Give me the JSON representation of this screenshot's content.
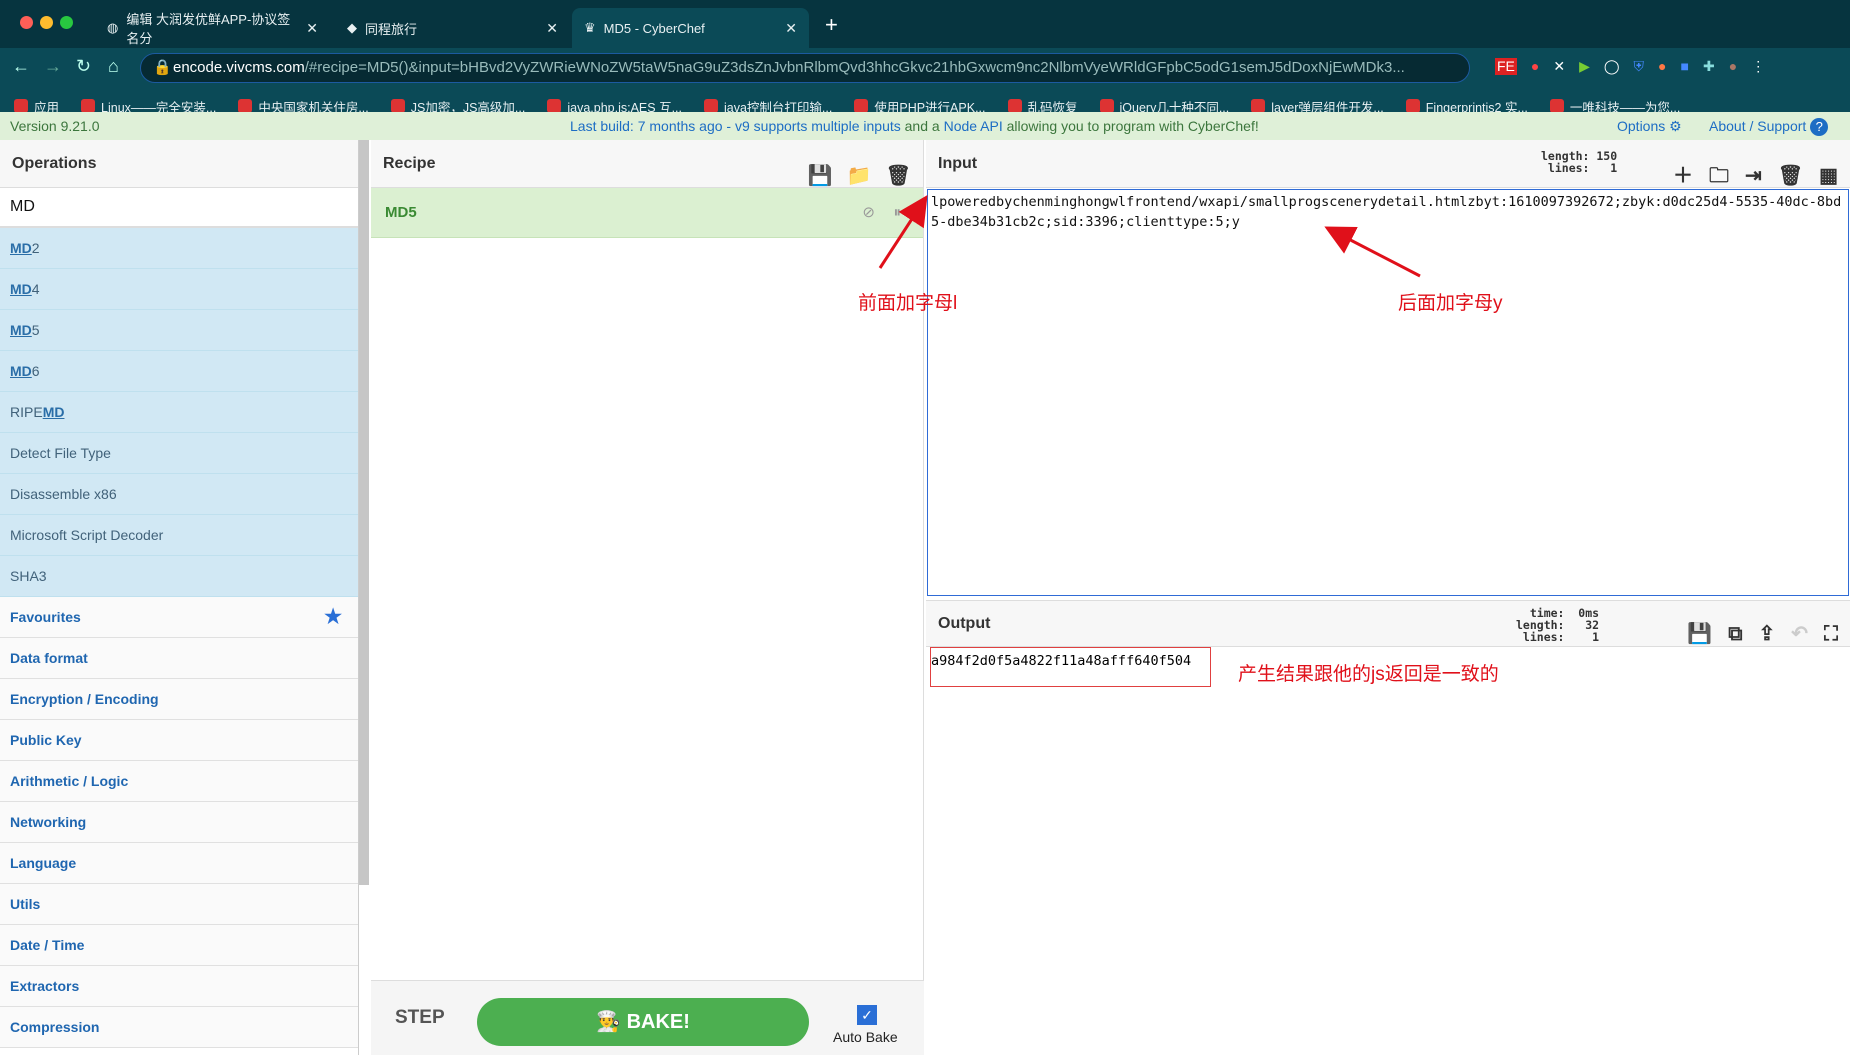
{
  "browser": {
    "tabs": [
      {
        "title": "编辑 大润发优鲜APP-协议签名分"
      },
      {
        "title": "同程旅行"
      },
      {
        "title": "MD5 - CyberChef",
        "active": true
      }
    ],
    "url_host": "encode.vivcms.com",
    "url_rest": "/#recipe=MD5()&input=bHBvd2VyZWRieWNoZW5taW5naG9uZ3dsZnJvbnRlbmQvd3hhcGkvc21hbGxwcm9nc2NlbmVyeWRldGFpbC5odG1semJ5dDoxNjEwMDk3...",
    "bookmarks": [
      "应用",
      "Linux——完全安装...",
      "中央国家机关住房...",
      "JS加密，JS高级加...",
      "java,php,js;AES 互...",
      "java控制台打印输...",
      "使用PHP进行APK...",
      "乱码恢复",
      "jQuery几十种不同...",
      "layer弹层组件开发...",
      "Fingerprintjs2 实...",
      "一唯科技——为您..."
    ]
  },
  "banner": {
    "version": "Version 9.21.0",
    "msg_a": "Last build: 7 months ago - v9 supports ",
    "msg_b": "multiple inputs",
    "msg_c": " and a ",
    "msg_d": "Node API",
    "msg_e": " allowing you to program with CyberChef!",
    "options": "Options",
    "about": "About / Support"
  },
  "operations": {
    "title": "Operations",
    "search": "MD",
    "results": [
      {
        "m": "MD",
        "r": "2"
      },
      {
        "m": "MD",
        "r": "4"
      },
      {
        "m": "MD",
        "r": "5"
      },
      {
        "m": "MD",
        "r": "6"
      },
      {
        "p": "RIPE",
        "m": "MD"
      }
    ],
    "other": [
      "Detect File Type",
      "Disassemble x86",
      "Microsoft Script Decoder",
      "SHA3"
    ],
    "categories": [
      "Favourites",
      "Data format",
      "Encryption / Encoding",
      "Public Key",
      "Arithmetic / Logic",
      "Networking",
      "Language",
      "Utils",
      "Date / Time",
      "Extractors",
      "Compression"
    ]
  },
  "recipe": {
    "title": "Recipe",
    "op": "MD5",
    "step": "STEP",
    "bake": "BAKE!",
    "auto_bake": "Auto Bake",
    "auto_bake_checked": true
  },
  "input": {
    "title": "Input",
    "stats": "length: 150\n lines:   1",
    "text": "lpoweredbychenminghongwlfrontend/wxapi/smallprogscenerydetail.htmlzbyt:1610097392672;zbyk:d0dc25d4-5535-40dc-8bd5-dbe34b31cb2c;sid:3396;clienttype:5;y"
  },
  "output": {
    "title": "Output",
    "stats": "  time:  0ms\nlength:   32\n lines:    1",
    "text": "a984f2d0f5a4822f11a48afff640f504"
  },
  "annotations": {
    "front": "前面加字母l",
    "back": "后面加字母y",
    "result": "产生结果跟他的js返回是一致的"
  },
  "colors": {
    "accent": "#4caf50",
    "annotation": "#e0101a"
  }
}
